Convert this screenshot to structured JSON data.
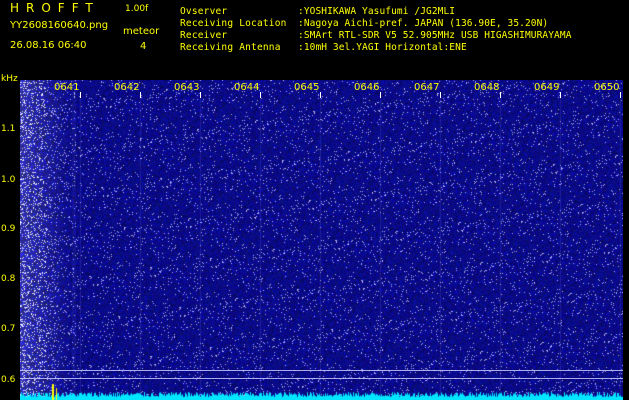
{
  "header": {
    "app_title": "HROFFT",
    "app_version": "1.00f",
    "filename": "YY2608160640.png",
    "datetime": "26.08.16 06:40",
    "meteor_label": "meteor",
    "meteor_count": "4",
    "info": [
      {
        "key": "Ovserver",
        "value": ":YOSHIKAWA Yasufumi /JG2MLI"
      },
      {
        "key": "Receiving Location",
        "value": ":Nagoya Aichi-pref. JAPAN (136.90E, 35.20N)"
      },
      {
        "key": "Receiver",
        "value": ":SMArt RTL-SDR V5 52.905MHz USB HIGASHIMURAYAMA"
      },
      {
        "key": "Receiving Antenna",
        "value": ":10mH 3el.YAGI Horizontal:ENE"
      }
    ]
  },
  "axis": {
    "unit": "kHz",
    "y_labels": [
      "1.1",
      "1.0",
      "0.9",
      "0.8",
      "0.7",
      "0.6"
    ],
    "x_labels": [
      "0641",
      "0642",
      "0643",
      "0644",
      "0645",
      "0646",
      "0647",
      "0648",
      "0649",
      "0650"
    ]
  },
  "colors": {
    "background": "#000000",
    "text": "#ffff00",
    "spectrogram_base": "#00008c",
    "noise_band": "#00ffff"
  }
}
